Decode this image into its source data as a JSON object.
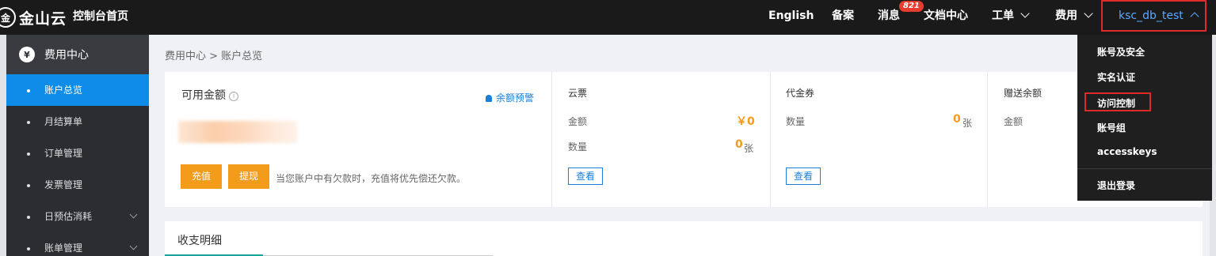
{
  "topbar": {
    "logo_mark": "金",
    "logo_text": "金山云",
    "console_home": "控制台首页",
    "nav": {
      "english": "English",
      "beian": "备案",
      "messages": "消息",
      "messages_badge": "821",
      "docs": "文档中心",
      "ticket": "工单",
      "fee": "费用"
    },
    "username": "ksc_db_test"
  },
  "user_menu": {
    "items": [
      "账号及安全",
      "实名认证",
      "访问控制",
      "账号组",
      "accesskeys"
    ],
    "logout": "退出登录",
    "highlighted": "访问控制"
  },
  "sidebar": {
    "title": "费用中心",
    "items": [
      {
        "label": "账户总览",
        "active": true
      },
      {
        "label": "月结算单"
      },
      {
        "label": "订单管理"
      },
      {
        "label": "发票管理"
      },
      {
        "label": "日预估消耗",
        "expandable": true
      },
      {
        "label": "账单管理",
        "expandable": true
      }
    ]
  },
  "breadcrumb": "费用中心 > 账户总览",
  "balance": {
    "title": "可用金额",
    "info_icon": "i",
    "alert_link": "余额预警",
    "recharge": "充值",
    "withdraw": "提现",
    "note": "当您账户中有欠款时，充值将优先偿还欠款。"
  },
  "cloud_ticket": {
    "title": "云票",
    "amount_label": "金额",
    "amount_value": "￥0",
    "count_label": "数量",
    "count_value": "0",
    "count_unit": "张",
    "view": "查看"
  },
  "voucher": {
    "title": "代金券",
    "count_label": "数量",
    "count_value": "0",
    "count_unit": "张",
    "view": "查看"
  },
  "gift": {
    "title": "赠送余额",
    "amount_label": "金额"
  },
  "detail": {
    "title": "收支明细"
  },
  "colors": {
    "topbar_bg": "#1a1a1a",
    "sidebar_bg": "#2b2d31",
    "active_blue": "#0f8ce8",
    "orange": "#f39c1c",
    "link_blue": "#1a7fd9",
    "highlight_red": "#e02a2a",
    "teal": "#19a49c"
  }
}
